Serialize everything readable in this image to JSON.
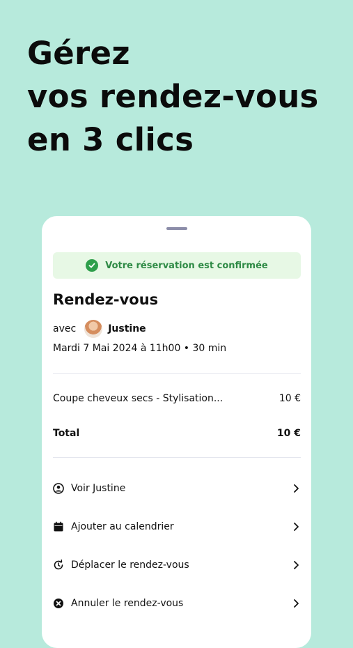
{
  "headline": [
    "Gérez",
    "vos rendez-vous",
    "en 3 clics"
  ],
  "banner": {
    "text": "Votre réservation est confirmée"
  },
  "appointment": {
    "title": "Rendez-vous",
    "with_label": "avec",
    "provider": "Justine",
    "datetime": "Mardi 7 Mai 2024 à 11h00 • 30 min"
  },
  "pricing": {
    "items": [
      {
        "label": "Coupe cheveux secs - Stylisation...",
        "price": "10 €"
      }
    ],
    "total_label": "Total",
    "total_value": "10 €"
  },
  "actions": [
    {
      "label": "Voir Justine",
      "icon": "user-circle-icon"
    },
    {
      "label": "Ajouter au calendrier",
      "icon": "calendar-icon"
    },
    {
      "label": "Déplacer le rendez-vous",
      "icon": "reschedule-icon"
    },
    {
      "label": "Annuler le rendez-vous",
      "icon": "cancel-icon"
    }
  ],
  "colors": {
    "background": "#b7eadc",
    "success": "#2e9f4b",
    "banner_bg": "#e7f8e5"
  }
}
